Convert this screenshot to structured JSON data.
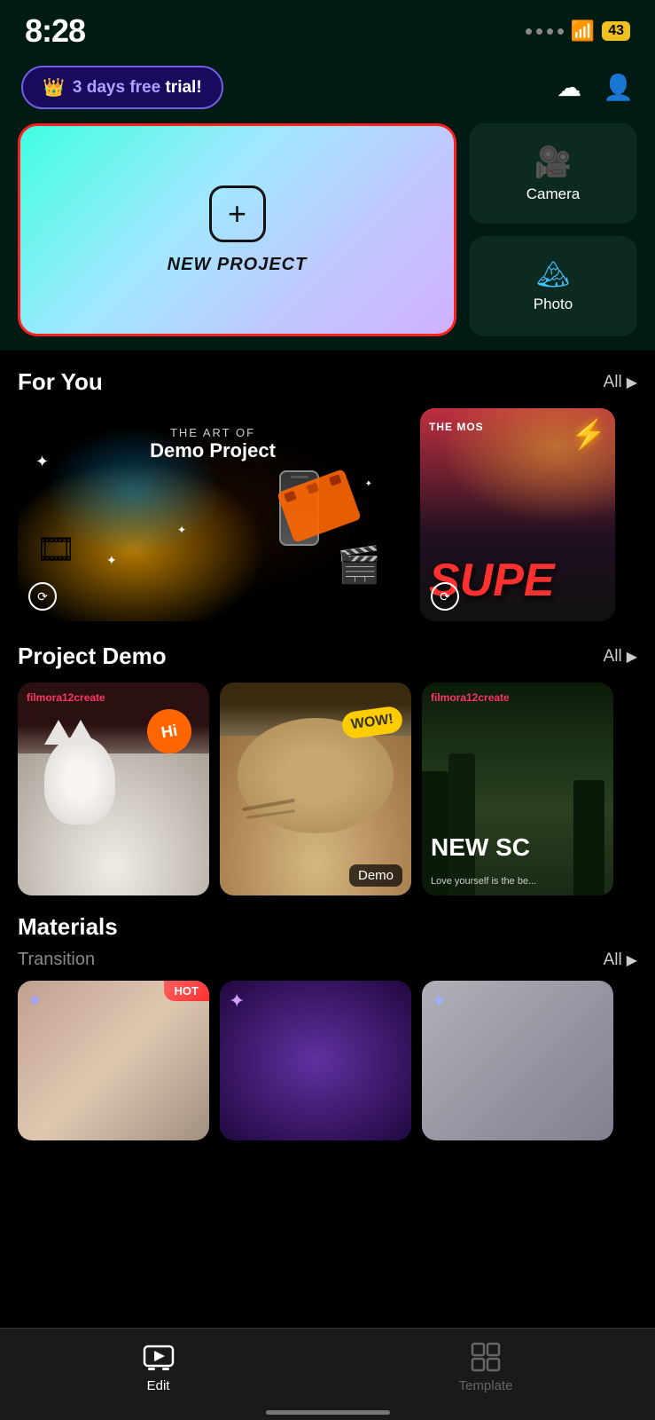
{
  "statusBar": {
    "time": "8:28",
    "battery": "43"
  },
  "header": {
    "trialText": {
      "prefix": "3 days free",
      "suffix": " trial!"
    },
    "cloudIcon": "☁",
    "userIcon": "👤"
  },
  "newProject": {
    "label": "NEW PROJECT"
  },
  "sideCards": [
    {
      "id": "camera",
      "label": "Camera",
      "icon": "🎥"
    },
    {
      "id": "photo",
      "label": "Photo",
      "icon": "🏔"
    }
  ],
  "forYou": {
    "title": "For You",
    "allLabel": "All",
    "cards": [
      {
        "artOf": "THE ART OF",
        "title": "Demo Project"
      },
      {
        "topText": "THE MOS",
        "bigText": "SUPE"
      }
    ]
  },
  "projectDemo": {
    "title": "Project Demo",
    "allLabel": "All",
    "cards": [
      {
        "overlay": "filmora12create",
        "bubble": "Hi"
      },
      {
        "bubble": "WOW!",
        "badge": "Demo"
      },
      {
        "overlay": "filmora12create",
        "bigText": "NEW SC",
        "bottomText": "Love yourself is the be..."
      }
    ]
  },
  "materials": {
    "title": "Materials",
    "transition": {
      "label": "Transition",
      "allLabel": "All",
      "cards": [
        {
          "hot": true
        },
        {},
        {}
      ]
    }
  },
  "bottomNav": {
    "items": [
      {
        "id": "edit",
        "label": "Edit",
        "active": true,
        "icon": "▶"
      },
      {
        "id": "template",
        "label": "Template",
        "active": false,
        "icon": "⊞"
      }
    ]
  }
}
